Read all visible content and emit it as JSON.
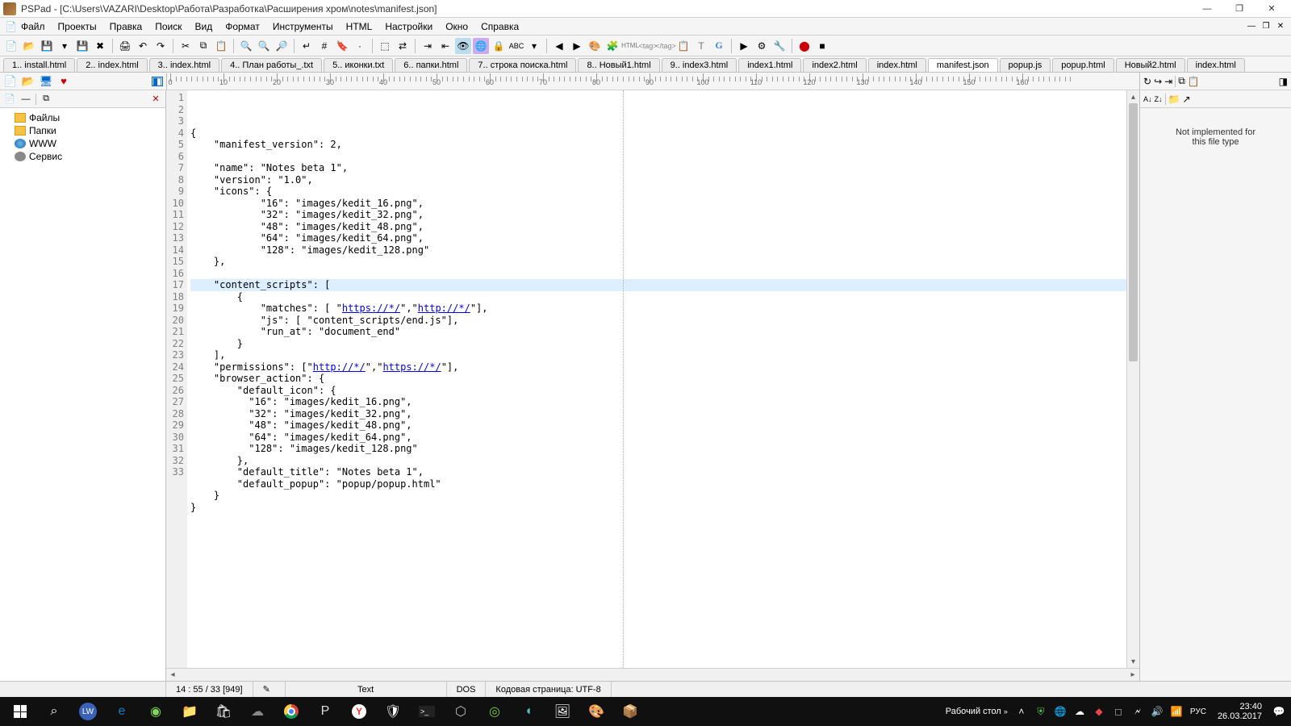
{
  "window": {
    "title": "PSPad - [C:\\Users\\VAZARI\\Desktop\\Работа\\Разработка\\Расширения хром\\notes\\manifest.json]"
  },
  "menus": [
    "Файл",
    "Проекты",
    "Правка",
    "Поиск",
    "Вид",
    "Формат",
    "Инструменты",
    "HTML",
    "Настройки",
    "Окно",
    "Справка"
  ],
  "doctabs": [
    {
      "label": "1.. install.html"
    },
    {
      "label": "2.. index.html"
    },
    {
      "label": "3.. index.html"
    },
    {
      "label": "4.. План работы_.txt"
    },
    {
      "label": "5.. иконки.txt"
    },
    {
      "label": "6.. папки.html"
    },
    {
      "label": "7.. строка поиска.html"
    },
    {
      "label": "8.. Новый1.html"
    },
    {
      "label": "9.. index3.html"
    },
    {
      "label": "index1.html"
    },
    {
      "label": "index2.html"
    },
    {
      "label": "index.html"
    },
    {
      "label": "manifest.json",
      "active": true
    },
    {
      "label": "popup.js"
    },
    {
      "label": "popup.html"
    },
    {
      "label": "Новый2.html"
    },
    {
      "label": "index.html"
    }
  ],
  "tree": [
    {
      "label": "Файлы",
      "icon": "folder"
    },
    {
      "label": "Папки",
      "icon": "folder"
    },
    {
      "label": "WWW",
      "icon": "globe"
    },
    {
      "label": "Сервис",
      "icon": "gear"
    }
  ],
  "rightpanel": {
    "message": "Not implemented for\nthis file type"
  },
  "ruler_ticks": [
    0,
    10,
    20,
    30,
    40,
    50,
    60,
    70,
    80,
    90,
    100,
    110,
    120,
    130,
    140,
    150,
    160
  ],
  "code": {
    "highlighted_line": 14,
    "lines": [
      "{",
      "    \"manifest_version\": 2,",
      "",
      "    \"name\": \"Notes beta 1\",",
      "    \"version\": \"1.0\",",
      "    \"icons\": {",
      "            \"16\": \"images/kedit_16.png\",",
      "            \"32\": \"images/kedit_32.png\",",
      "            \"48\": \"images/kedit_48.png\",",
      "            \"64\": \"images/kedit_64.png\",",
      "            \"128\": \"images/kedit_128.png\"",
      "    },",
      "",
      "    \"content_scripts\": [",
      "        {",
      "            \"matches\": [ \"<a class='url'>https://*/</a>\",\"<a class='url'>http://*/</a>\"],",
      "            \"js\": [ \"content_scripts/end.js\"],",
      "            \"run_at\": \"document_end\"",
      "        }",
      "    ],",
      "    \"permissions\": [\"<a class='url'>http://*/</a>\",\"<a class='url'>https://*/</a>\"],",
      "    \"browser_action\": {",
      "        \"default_icon\": {",
      "          \"16\": \"images/kedit_16.png\",",
      "          \"32\": \"images/kedit_32.png\",",
      "          \"48\": \"images/kedit_48.png\",",
      "          \"64\": \"images/kedit_64.png\",",
      "          \"128\": \"images/kedit_128.png\"",
      "        },",
      "        \"default_title\": \"Notes beta 1\",",
      "        \"default_popup\": \"popup/popup.html\"",
      "    }",
      "}"
    ]
  },
  "status": {
    "pos": "14 : 55 / 33  [949]",
    "mode": "Text",
    "eol": "DOS",
    "codepage": "Кодовая страница: UTF-8"
  },
  "taskbar": {
    "desktop_label": "Рабочий стол",
    "lang": "РУС",
    "time": "23:40",
    "date": "26.03.2017"
  }
}
